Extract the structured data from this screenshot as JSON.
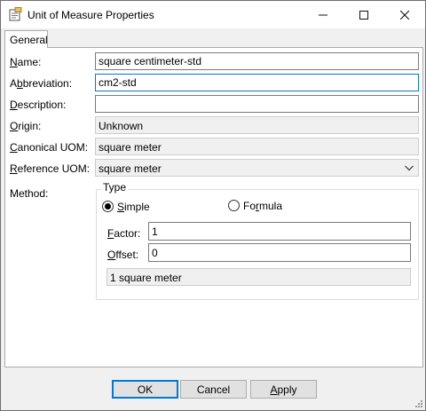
{
  "window": {
    "title": "Unit of Measure Properties",
    "controls": {
      "minimize": "—",
      "maximize": "☐",
      "close": "✕"
    }
  },
  "tabs": [
    {
      "label": "General"
    }
  ],
  "form": {
    "name": {
      "label_first": "N",
      "label_rest": "ame:",
      "value": "square centimeter-std"
    },
    "abbreviation": {
      "label_first": "A",
      "label_mid": "b",
      "label_rest": "breviation:",
      "value": "cm2-std"
    },
    "description": {
      "label_first": "D",
      "label_rest": "escription:",
      "value": ""
    },
    "origin": {
      "label_first": "O",
      "label_rest": "rigin:",
      "value": "Unknown"
    },
    "canonical_uom": {
      "label_first": "C",
      "label_rest": "anonical UOM:",
      "value": "square meter"
    },
    "reference_uom": {
      "label_first": "R",
      "label_rest": "eference UOM:",
      "value": "square meter"
    },
    "method": {
      "label": "Method:"
    }
  },
  "type_group": {
    "legend": "Type",
    "simple": {
      "label_first": "S",
      "label_rest": "imple",
      "selected": true
    },
    "formula": {
      "label_pre": "Fo",
      "label_mid": "r",
      "label_rest": "mula",
      "selected": false
    },
    "factor": {
      "label_first": "F",
      "label_rest": "actor:",
      "value": "1"
    },
    "offset": {
      "label_first": "O",
      "label_rest": "ffset:",
      "value": "0"
    },
    "result": "1 square meter"
  },
  "buttons": {
    "ok": "OK",
    "cancel": "Cancel",
    "apply_first": "A",
    "apply_rest": "pply"
  },
  "colors": {
    "focus_border": "#0078d7",
    "window_bg": "#f0f0f0"
  }
}
